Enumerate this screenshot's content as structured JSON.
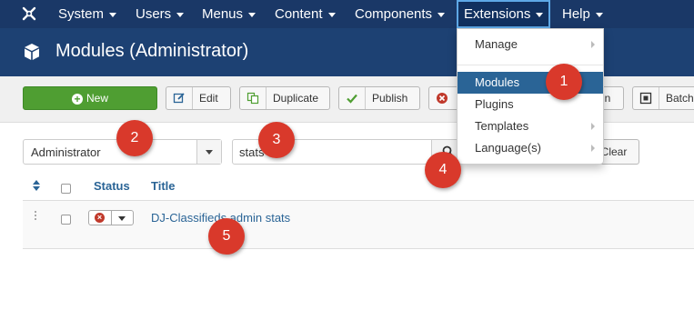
{
  "navbar": {
    "items": [
      {
        "label": "System"
      },
      {
        "label": "Users"
      },
      {
        "label": "Menus"
      },
      {
        "label": "Content"
      },
      {
        "label": "Components"
      },
      {
        "label": "Extensions"
      },
      {
        "label": "Help"
      }
    ],
    "active": "Extensions"
  },
  "header": {
    "title": "Modules (Administrator)"
  },
  "toolbar": {
    "new_label": "New",
    "edit_label": "Edit",
    "duplicate_label": "Duplicate",
    "publish_label": "Publish",
    "partial_label": "in",
    "batch_label": "Batch"
  },
  "filters": {
    "client_value": "Administrator",
    "search_value": "stats",
    "clear_label": "Clear"
  },
  "table": {
    "headers": {
      "status": "Status",
      "title": "Title"
    },
    "rows": [
      {
        "title": "DJ-Classifieds admin stats",
        "status": "unpublished"
      }
    ]
  },
  "extensions_menu": {
    "items": [
      {
        "label": "Manage",
        "has_submenu": true
      },
      {
        "label": "Modules",
        "has_submenu": false,
        "active": true
      },
      {
        "label": "Plugins",
        "has_submenu": false
      },
      {
        "label": "Templates",
        "has_submenu": true
      },
      {
        "label": "Language(s)",
        "has_submenu": true
      }
    ]
  },
  "callouts": [
    "1",
    "2",
    "3",
    "4",
    "5"
  ],
  "colors": {
    "navbar": "#1a3867",
    "titlebar": "#1d4173",
    "new_button": "#4f9e32",
    "menu_active": "#2a6496",
    "callout": "#d9392b",
    "link": "#2a6496"
  }
}
